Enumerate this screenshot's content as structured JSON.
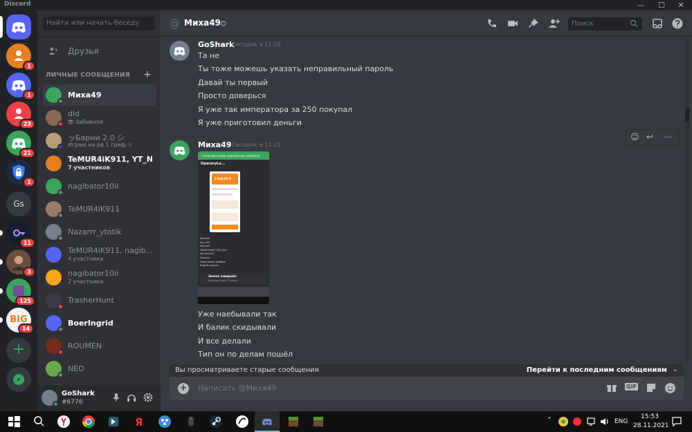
{
  "window": {
    "app_name": "Discord",
    "min_glyph": "—",
    "max_glyph": "☐",
    "close_glyph": "✕"
  },
  "servers": [
    {
      "name": "home-logo",
      "badge": ""
    },
    {
      "name": "server-1",
      "badge": "1"
    },
    {
      "name": "server-2",
      "badge": "1"
    },
    {
      "name": "server-3",
      "badge": "23"
    },
    {
      "name": "server-4",
      "badge": "21"
    },
    {
      "name": "server-5",
      "badge": "1"
    },
    {
      "name": "server-gs",
      "label": "Gs",
      "badge": ""
    },
    {
      "name": "server-keydrop",
      "badge": "11"
    },
    {
      "name": "server-8",
      "badge": "3"
    },
    {
      "name": "server-9",
      "badge": "125"
    },
    {
      "name": "server-big",
      "label": "BIG",
      "badge": "14"
    }
  ],
  "dm": {
    "search_placeholder": "Найти или начать беседу",
    "friends_label": "Друзья",
    "header": "ЛИЧНЫЕ СООБЩЕНИЯ",
    "add_glyph": "+",
    "items": [
      {
        "name": "Миха49",
        "sub": ""
      },
      {
        "name": "did",
        "sub": "😎 Забивной"
      },
      {
        "name": "ッБарни 2.0 シ",
        "sub": "Играю на рв 1 гриф :)"
      },
      {
        "name": "TeMUR4iK911, YT_N...",
        "sub": "7 участников"
      },
      {
        "name": "nagibator10ii",
        "sub": ""
      },
      {
        "name": "TeMUR4iK911",
        "sub": ""
      },
      {
        "name": "Nazarrr_ytotik",
        "sub": ""
      },
      {
        "name": "TeMUR4iK911, nagib...",
        "sub": "4 участника"
      },
      {
        "name": "nagibator10ii",
        "sub": "2 участника"
      },
      {
        "name": "TrasherHunt",
        "sub": ""
      },
      {
        "name": "BoerIngrid",
        "sub": ""
      },
      {
        "name": "ROUMEN",
        "sub": ""
      },
      {
        "name": "NEO",
        "sub": ""
      }
    ]
  },
  "user": {
    "name": "GoShark",
    "tag": "#6776"
  },
  "chat": {
    "at_glyph": "@",
    "title": "Миха49",
    "search_placeholder": "Поиск",
    "messages": [
      {
        "author": "GoShark",
        "time": "Сегодня, в 11:19",
        "lines": [
          "Та не",
          "Ты тоже можешь указать неправильный пароль",
          "Давай ты первый",
          "Просто доверься",
          "Я уже так императора за 250 покупал",
          "Я уже приготовил деньги"
        ]
      },
      {
        "author": "Миха49",
        "time": "Сегодня, в 11:21",
        "lines": [
          "Уже наебывали так",
          "И балик скидывали",
          "И все делали",
          "Тип он по делам пошёл"
        ]
      }
    ],
    "old_messages_text": "Вы просматриваете старые сообщения",
    "jump_text": "Перейти к последним сообщениям",
    "chevron_glyph": "⌄",
    "composer_placeholder": "Написать @Миха49",
    "plus_glyph": "+",
    "gif_label": "GIF"
  },
  "screenshot": {
    "banner": "Голосовая связь подключена: pdmbk22",
    "header_name": "OpenmyLo...",
    "balance": "2 044,85 ₽",
    "chat_lines": [
      "Миха49",
      "bzs_232",
      "Миха49",
      "ЗМИЙ ИМЯ ГТМ 1042",
      "Aveline192",
      "Смотри",
      "Покупаешь вообще",
      "Кидаю пароль"
    ],
    "call_title": "Звонок завершён",
    "call_sub": "Длилась около 2 минут"
  },
  "taskbar": {
    "lang": "ENG",
    "time": "15:53",
    "date": "28.11.2021"
  },
  "colors": {
    "blurple": "#5865f2",
    "green": "#3ba55d",
    "red": "#ed4245",
    "orange": "#e67e22",
    "yellow": "#faa61a"
  }
}
